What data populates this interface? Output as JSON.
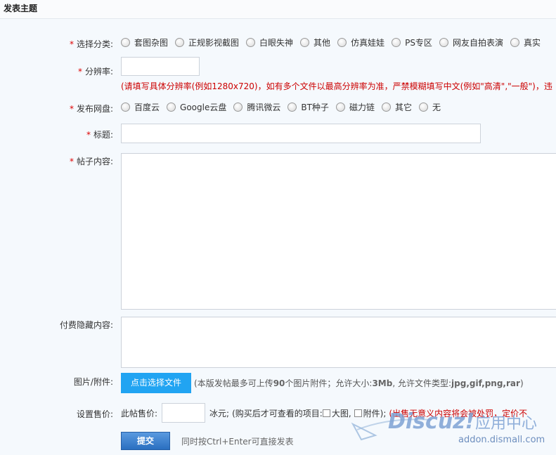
{
  "header": {
    "title": "发表主题"
  },
  "category": {
    "label": "选择分类:",
    "options": [
      "套图杂图",
      "正规影视截图",
      "白眼失神",
      "其他",
      "仿真娃娃",
      "PS专区",
      "网友自拍表演",
      "真实"
    ]
  },
  "resolution": {
    "label": "分辨率:",
    "value": "",
    "hint": "(请填写具体分辨率(例如1280x720)，如有多个文件以最高分辨率为准，严禁模糊填写中文(例如\"高清\",\"一般\")，违"
  },
  "netdisk": {
    "label": "发布网盘:",
    "options": [
      "百度云",
      "Google云盘",
      "腾讯微云",
      "BT种子",
      "磁力链",
      "其它",
      "无"
    ]
  },
  "subject": {
    "label": "标题:",
    "value": ""
  },
  "content": {
    "label": "帖子内容:",
    "value": ""
  },
  "paid_content": {
    "label": "付费隐藏内容:",
    "value": ""
  },
  "attachment": {
    "label": "图片/附件:",
    "button": "点击选择文件",
    "note_prefix": "(本版发帖最多可上传",
    "max_count": "90",
    "note_mid": "个图片附件；允许大小:",
    "max_size": "3Mb",
    "note_types_label": ", 允许文件类型:",
    "types": "jpg,gif,png,rar",
    "note_suffix": ")"
  },
  "price": {
    "label": "设置售价:",
    "prefix": "此帖售价:",
    "value": "",
    "unit": "冰元;",
    "items_label": "(购买后才可查看的项目:",
    "opt1": "大图,",
    "opt2": "附件);",
    "warning": "(出售无意义内容将会被处罚，定价不"
  },
  "submit": {
    "button": "提交",
    "hint": "同时按Ctrl+Enter可直接发表"
  },
  "watermark": {
    "logo": "Discuz!",
    "tagline": "应用中心",
    "url": "addon.dismall.com"
  },
  "colors": {
    "accent": "#21a4f2",
    "required": "#dd0000",
    "warning": "#cc0000",
    "submit": "#2a6fc0"
  }
}
